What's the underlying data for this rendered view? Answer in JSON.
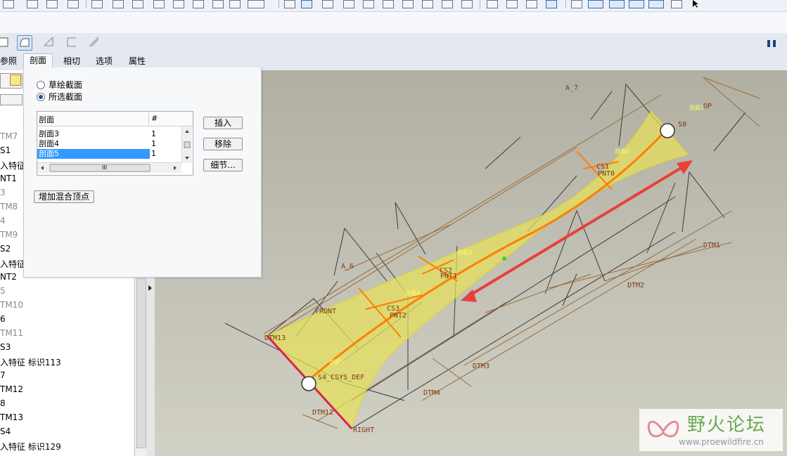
{
  "dashboard": {
    "tabs": [
      "参照",
      "剖面",
      "相切",
      "选项",
      "属性"
    ],
    "active_tab": "剖面"
  },
  "sections_panel": {
    "radio_sketched": "草绘截面",
    "radio_selected": "所选截面",
    "table_headers": [
      "剖面",
      "#"
    ],
    "rows": [
      {
        "name": "剖面3",
        "count": "1"
      },
      {
        "name": "剖面4",
        "count": "1"
      },
      {
        "name": "剖面5",
        "count": "1"
      }
    ],
    "selected_row": 2,
    "btn_insert": "插入",
    "btn_remove": "移除",
    "btn_details": "细节...",
    "btn_add_vertex": "增加混合顶点",
    "hscroll_grip": "III"
  },
  "model_tree": {
    "items": [
      {
        "label": "TM7",
        "dim": true
      },
      {
        "label": "S1",
        "dim": false
      },
      {
        "label": "入特征",
        "dim": false
      },
      {
        "label": "NT1",
        "dim": false
      },
      {
        "label": "3",
        "dim": true
      },
      {
        "label": "TM8",
        "dim": true
      },
      {
        "label": "4",
        "dim": true
      },
      {
        "label": "TM9",
        "dim": true
      },
      {
        "label": "S2",
        "dim": false
      },
      {
        "label": "入特征",
        "dim": false
      },
      {
        "label": "NT2",
        "dim": false
      },
      {
        "label": "5",
        "dim": true
      },
      {
        "label": "TM10",
        "dim": true
      },
      {
        "label": "6",
        "dim": false
      },
      {
        "label": "TM11",
        "dim": true
      },
      {
        "label": "S3",
        "dim": false
      },
      {
        "label": "入特征 标识113",
        "dim": false
      },
      {
        "label": "7",
        "dim": false
      },
      {
        "label": "TM12",
        "dim": false
      },
      {
        "label": "8",
        "dim": false
      },
      {
        "label": "TM13",
        "dim": false
      },
      {
        "label": "S4",
        "dim": false
      },
      {
        "label": "入特征 标识129",
        "dim": false
      }
    ]
  },
  "viewport": {
    "labels": {
      "a7": "A_7",
      "a6": "A_6",
      "front": "FRONT",
      "right": "RIGHT",
      "dtm1": "DTM1",
      "dtm2": "DTM2",
      "dtm3": "DTM3",
      "dtm4": "DTM4",
      "dtm13": "DTM13",
      "dtm12": "DTM12",
      "cs4": "S4_CSYS_DEF",
      "cs3": "CS3",
      "cs2": "CS2",
      "cs1": "CS1",
      "pnt2": "PNT2",
      "pnt1": "PNT1",
      "pnt0": "PNT0",
      "cs0": "S0",
      "sec1": "剖面1",
      "sec2": "剖面2",
      "sec3": "剖面3",
      "sec4": "剖面4",
      "sec5": "剖面5",
      "top": "OP"
    },
    "colors": {
      "surface": "#e6e15a",
      "trajectory": "#ff7f00",
      "arrow": "#e8403a",
      "datum": "#8a5a2b",
      "background": "#b6b4a6"
    }
  },
  "watermark": {
    "title": "野火论坛",
    "url": "www.proewildfire.cn"
  }
}
